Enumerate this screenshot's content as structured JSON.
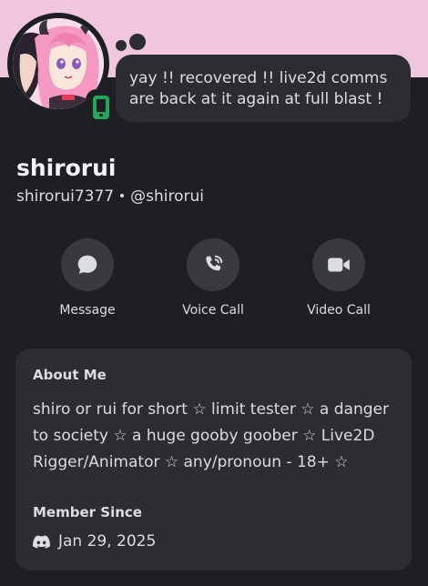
{
  "profile": {
    "display_name": "shirorui",
    "username": "shirorui7377",
    "handle": "@shirorui",
    "status_device": "mobile",
    "custom_status": "yay !! recovered !! live2d comms are back at it again at full blast !"
  },
  "actions": [
    {
      "label": "Message",
      "icon": "chat-bubble-icon"
    },
    {
      "label": "Voice Call",
      "icon": "phone-call-icon"
    },
    {
      "label": "Video Call",
      "icon": "video-camera-icon"
    }
  ],
  "about": {
    "heading": "About Me",
    "bio": "shiro or rui for short ☆ limit tester ☆ a danger to society ☆ a huge gooby goober ☆ Live2D Rigger/Animator ☆ any/pronoun - 18+ ☆"
  },
  "member_since": {
    "heading": "Member Since",
    "date": "Jan 29, 2025",
    "icon": "discord-logo-icon"
  },
  "colors": {
    "banner": "#f0c6dc",
    "background": "#1e1f22",
    "card": "#2b2d31",
    "button": "#383a40",
    "online_mobile": "#23a55a"
  }
}
